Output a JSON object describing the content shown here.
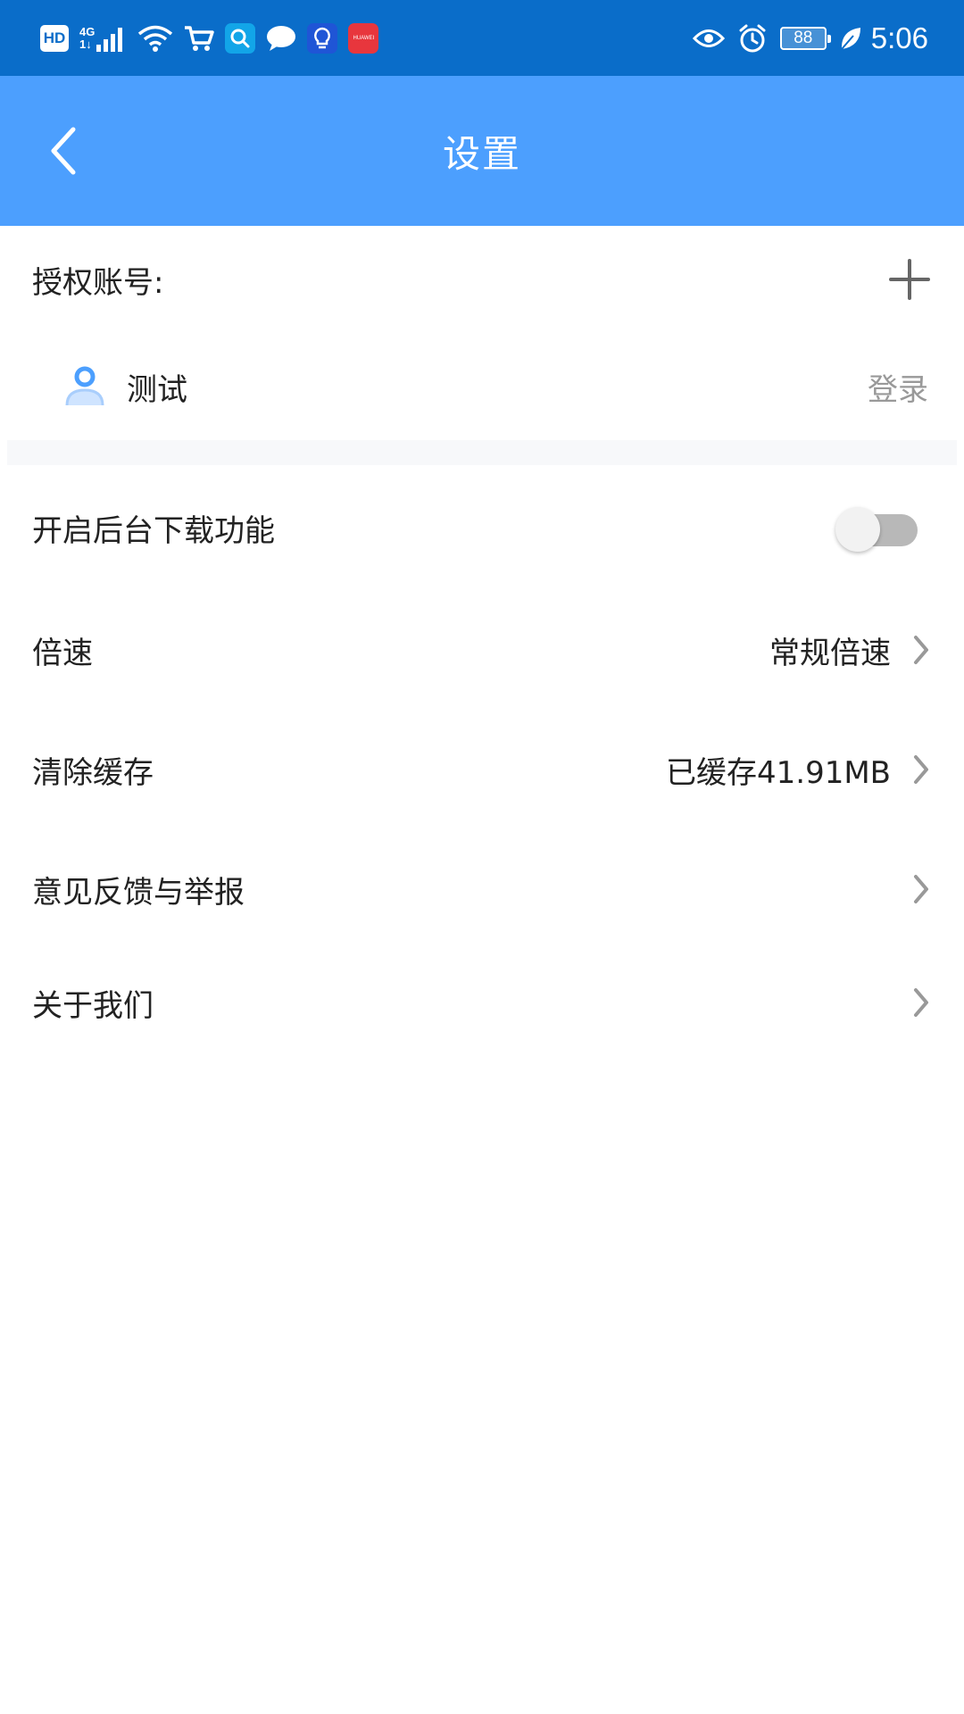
{
  "status_bar": {
    "hd_label": "HD",
    "network_top": "4G",
    "network_bottom": "1↓",
    "huawei_label": "HUAWEI",
    "battery": "88",
    "time": "5:06"
  },
  "header": {
    "title": "设置"
  },
  "accounts": {
    "label": "授权账号:",
    "items": [
      {
        "name": "测试",
        "action": "登录"
      }
    ]
  },
  "settings": {
    "background_download": {
      "label": "开启后台下载功能",
      "enabled": false
    },
    "speed": {
      "label": "倍速",
      "value": "常规倍速"
    },
    "cache": {
      "label": "清除缓存",
      "value": "已缓存41.91MB"
    },
    "feedback": {
      "label": "意见反馈与举报"
    },
    "about": {
      "label": "关于我们"
    }
  },
  "colors": {
    "status_bar_bg": "#0a6dc9",
    "header_bg": "#4c9ffe",
    "avatar": "#4c9ffe",
    "toggle_off": "#b8b8b8"
  }
}
